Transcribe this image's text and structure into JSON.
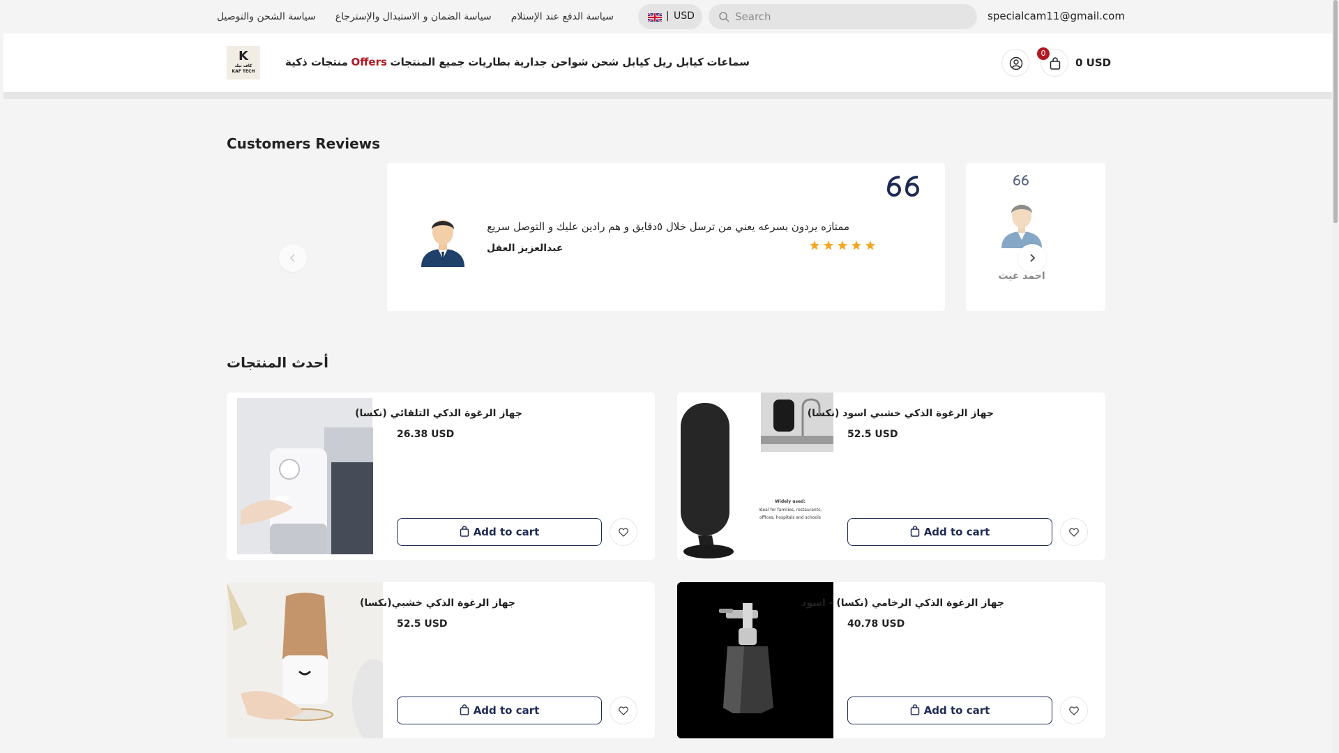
{
  "topbar": {
    "email": "specialcam11@gmail.com",
    "search_placeholder": "Search",
    "currency_code": "USD",
    "currency_sep": "|",
    "links": [
      "سياسة الدفع عند الإستلام",
      "سياسة الضمان و الاستبدال والإسترجاع",
      "سياسة الشحن والتوصيل"
    ]
  },
  "header": {
    "logo_mark": "K",
    "logo_sub1": "كاف تيك",
    "logo_sub2": "KAF TECH",
    "nav": [
      "سماعات",
      "كيابل ريل",
      "كيابل شحن",
      "شواحن جدارية",
      "بطاريات",
      "جميع المنتجات",
      "Offers",
      "منتجات ذكية"
    ],
    "cart_count": "0",
    "cart_total": "0 USD",
    "accent": "#b01822"
  },
  "reviews": {
    "title": "Customers Reviews",
    "main": {
      "text": "ممتازه يردون بسرعه يعني من ترسل خلال ٥دقايق و هم رادين عليك و التوصل سريع",
      "name": "عبدالعزيز العقل",
      "rating": 5
    },
    "next": {
      "name": "احمد غيث"
    }
  },
  "products": {
    "title": "أحدث المنتجات",
    "add_label": "Add to cart",
    "items": [
      {
        "name": "جهاز الرغوة الذكي التلقائي (نكسا)",
        "price": "26.38 USD"
      },
      {
        "name": "جهاز الرغوة الذكي خشبي اسود (نكسا)",
        "price": "52.5 USD"
      },
      {
        "name": "جهاز الرغوة الذكي خشبي(نكسا)",
        "price": "52.5 USD"
      },
      {
        "name": "جهاز الرغوة الذكي الرخامي (نكسا) - اسود",
        "price": "40.78 USD"
      }
    ],
    "image_text": {
      "line1": "Widely used:",
      "line2": "Ideal for families, restaurants,",
      "line3": "offices, hospitals and schools"
    }
  },
  "colors": {
    "navy": "#1e2a55",
    "star": "#f5a623"
  }
}
